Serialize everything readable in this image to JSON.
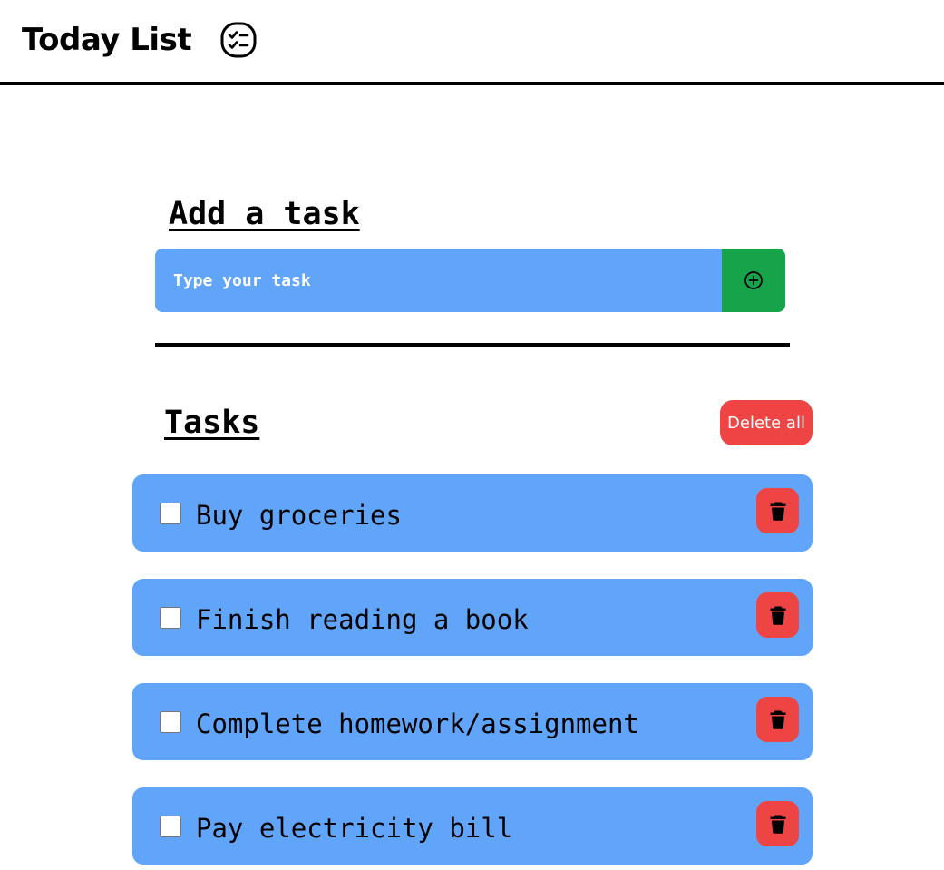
{
  "header": {
    "title": "Today List",
    "icon": "checklist-icon"
  },
  "add_task": {
    "heading": "Add a task",
    "input_placeholder": "Type your task",
    "input_value": "",
    "add_icon": "plus-circle-icon"
  },
  "tasks_section": {
    "heading": "Tasks",
    "delete_all_label": "Delete all",
    "delete_icon": "trash-icon"
  },
  "tasks": [
    {
      "text": "Buy groceries",
      "done": false
    },
    {
      "text": "Finish reading a book",
      "done": false
    },
    {
      "text": "Complete homework/assignment",
      "done": false
    },
    {
      "text": "Pay electricity bill",
      "done": false
    }
  ],
  "colors": {
    "task_bg": "#60a5fa",
    "add_button": "#16a34a",
    "danger": "#ef4444",
    "text": "#000000"
  }
}
